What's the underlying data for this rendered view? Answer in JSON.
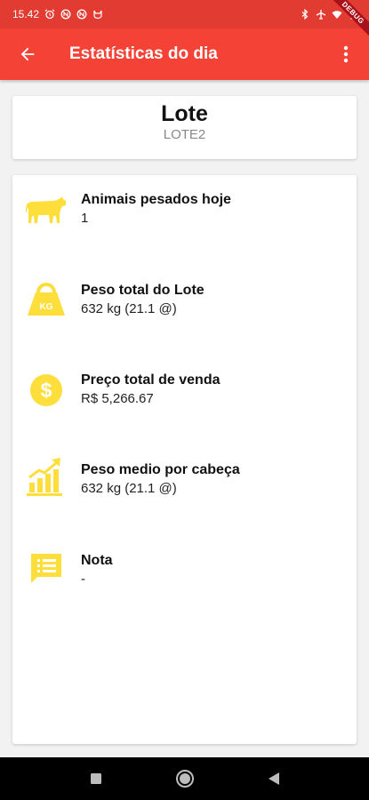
{
  "status_bar": {
    "time": "15.42",
    "left_icons": [
      "alarm-icon",
      "nfc-icon",
      "nfc-icon",
      "cat-icon"
    ],
    "right_icons": [
      "bluetooth-icon",
      "airplane-icon",
      "wifi-icon",
      "battery-icon"
    ]
  },
  "app_bar": {
    "title": "Estatísticas do dia",
    "background": "#f44336"
  },
  "debug_banner": {
    "label": "DEBUG"
  },
  "lote": {
    "title": "Lote",
    "name": "LOTE2"
  },
  "stats": [
    {
      "icon": "cow-icon",
      "label": "Animais pesados hoje",
      "value": "1"
    },
    {
      "icon": "weight-kg-icon",
      "label": "Peso total do Lote",
      "value": "632 kg (21.1 @)"
    },
    {
      "icon": "dollar-coin-icon",
      "label": "Preço total de venda",
      "value": "R$ 5,266.67"
    },
    {
      "icon": "growth-chart-icon",
      "label": "Peso medio por cabeça",
      "value": "632 kg (21.1 @)"
    },
    {
      "icon": "note-icon",
      "label": "Nota",
      "value": "-"
    }
  ],
  "colors": {
    "icon_yellow": "#fdde3a",
    "status_bar": "#e23b32"
  },
  "nav_bar": {
    "buttons": [
      "recents-icon",
      "home-icon",
      "back-icon"
    ]
  }
}
